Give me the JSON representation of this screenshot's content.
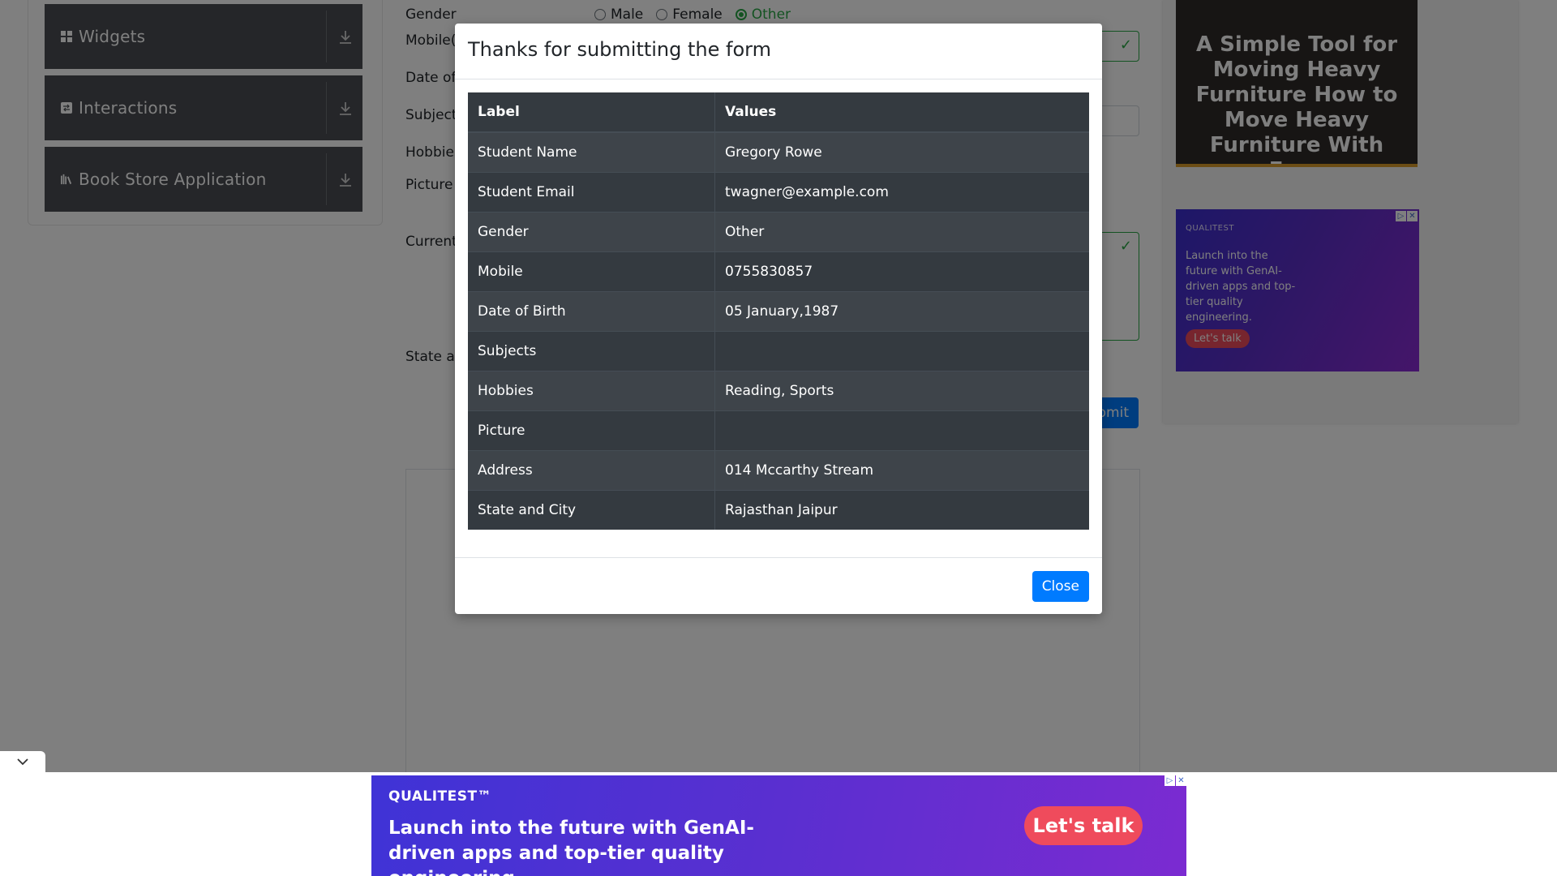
{
  "sidebar": {
    "groups": [
      {
        "label": "Widgets",
        "icon": "widgets-icon"
      },
      {
        "label": "Interactions",
        "icon": "interactions-icon"
      },
      {
        "label": "Book Store Application",
        "icon": "book-icon"
      }
    ]
  },
  "form": {
    "gender_label": "Gender",
    "mobile_label": "Mobile(",
    "dob_label": "Date of",
    "subjects_label": "Subjects",
    "hobbies_label": "Hobbies",
    "picture_label": "Picture",
    "address_label": "Current",
    "state_label": "State an",
    "gender_options": [
      "Male",
      "Female",
      "Other"
    ],
    "gender_selected": "Other",
    "submit_label": "bmit"
  },
  "ads": {
    "side_ad_1_text": "A Simple Tool for Moving Heavy Furniture How to Move Heavy Furniture With Ease",
    "side_ad_2": {
      "brand": "QUALITEST",
      "message": "Launch into the future with GenAI-driven apps and top-tier quality engineering.",
      "cta": "Let's talk"
    },
    "bottom_ad": {
      "brand": "QUALITEST™",
      "message": "Launch into the future with GenAI-driven apps and top-tier quality engineering.",
      "cta": "Let's talk"
    }
  },
  "modal": {
    "title": "Thanks for submitting the form",
    "columns": [
      "Label",
      "Values"
    ],
    "rows": [
      {
        "label": "Student Name",
        "value": "Gregory Rowe"
      },
      {
        "label": "Student Email",
        "value": "twagner@example.com"
      },
      {
        "label": "Gender",
        "value": "Other"
      },
      {
        "label": "Mobile",
        "value": "0755830857"
      },
      {
        "label": "Date of Birth",
        "value": "05 January,1987"
      },
      {
        "label": "Subjects",
        "value": ""
      },
      {
        "label": "Hobbies",
        "value": "Reading, Sports"
      },
      {
        "label": "Picture",
        "value": ""
      },
      {
        "label": "Address",
        "value": "014 Mccarthy Stream"
      },
      {
        "label": "State and City",
        "value": "Rajasthan Jaipur"
      }
    ],
    "close_label": "Close"
  },
  "colors": {
    "primary": "#007bff",
    "valid": "#28a745",
    "table_dark": "#343a40",
    "sidebar_group": "#4a4d52"
  }
}
